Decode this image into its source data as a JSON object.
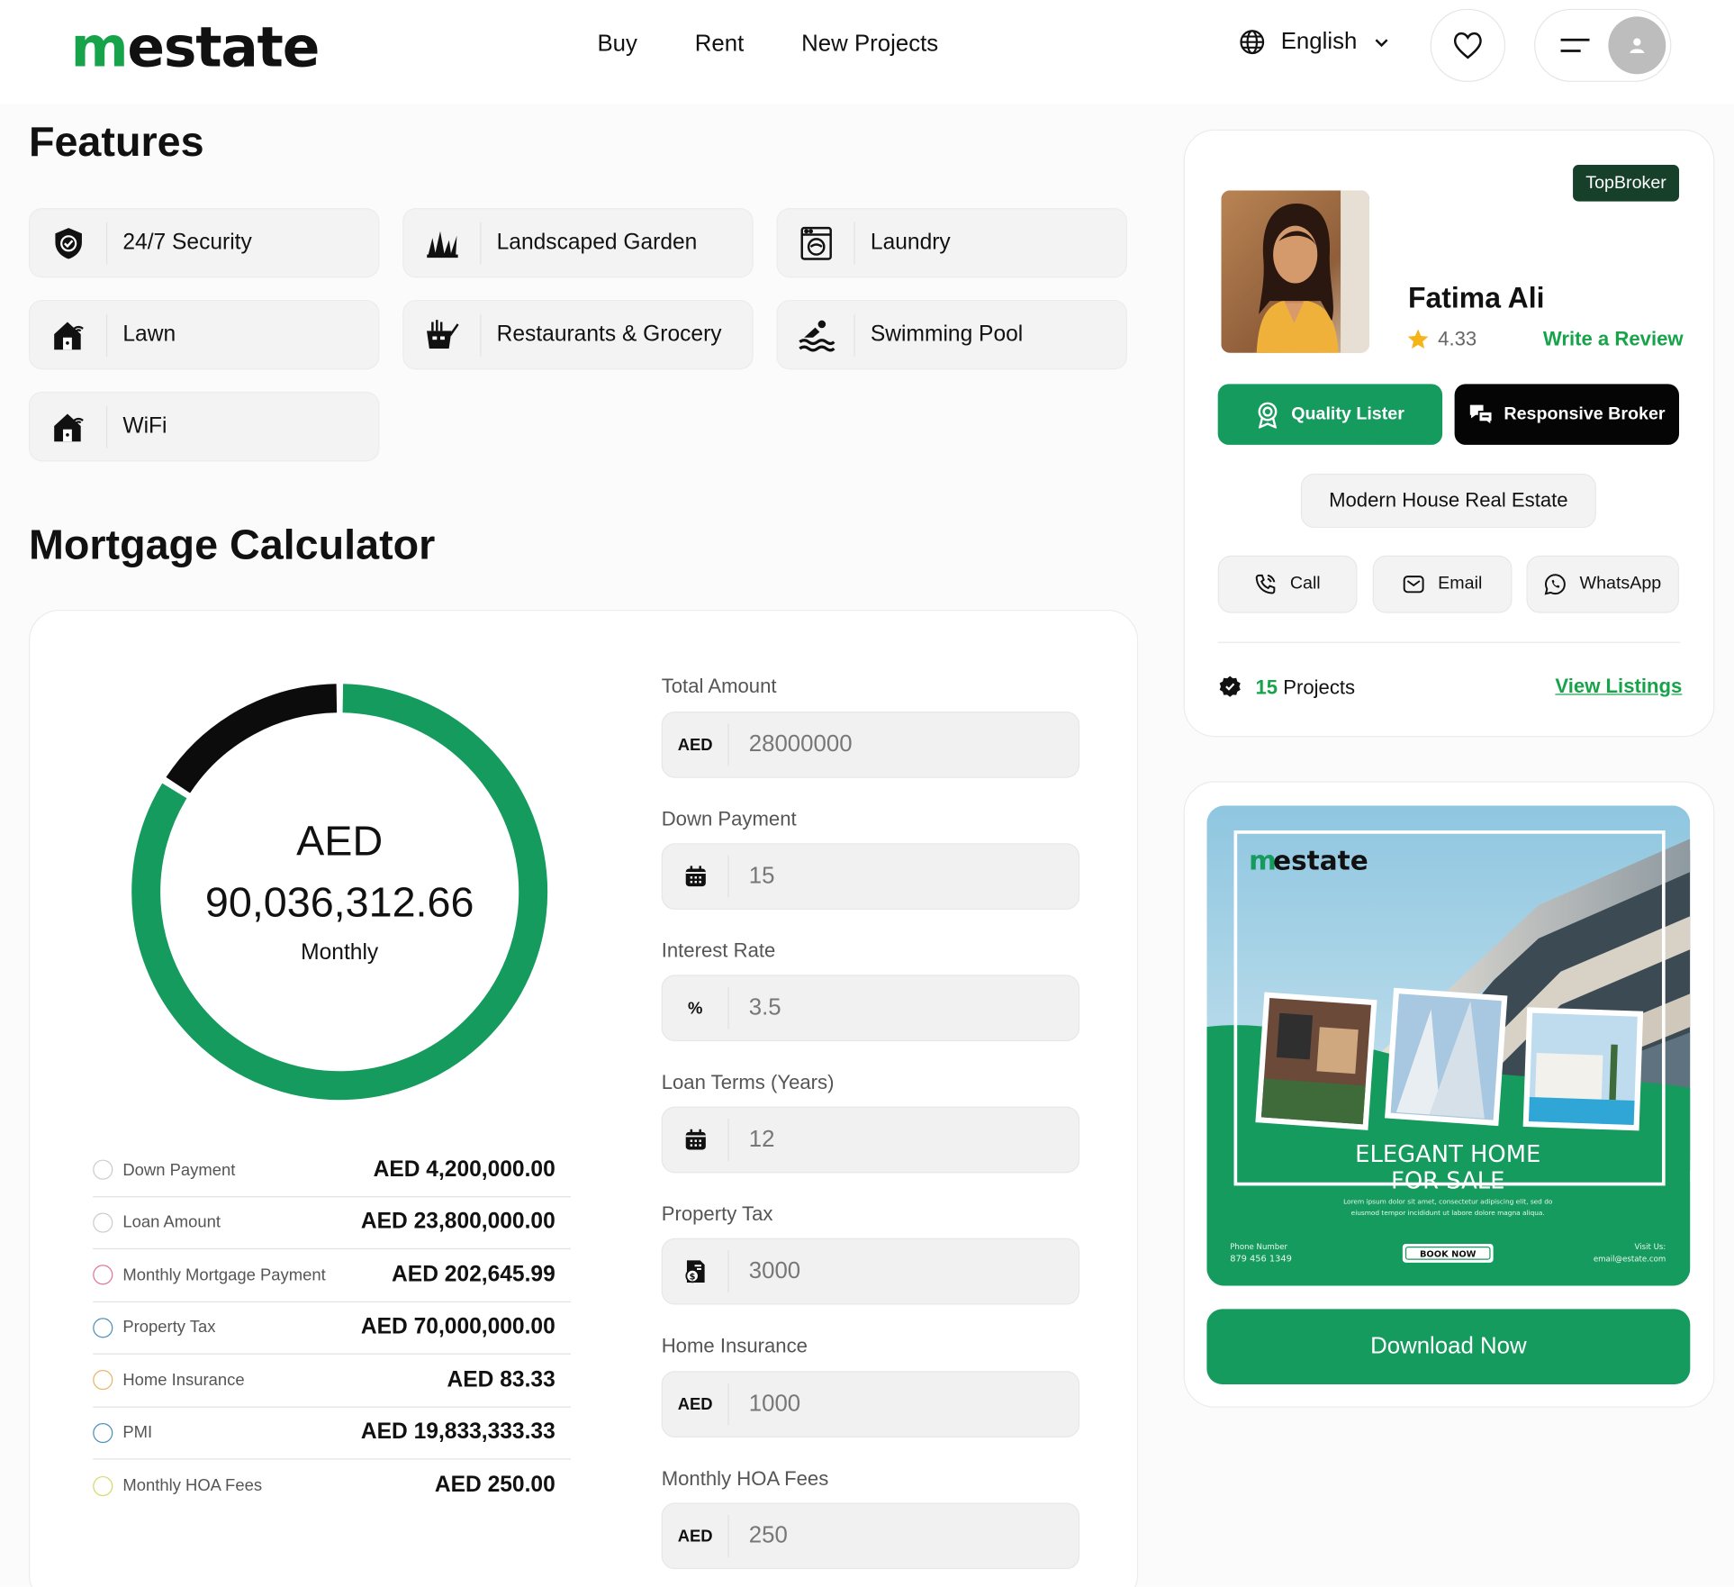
{
  "header": {
    "logo_m": "m",
    "logo_rest": "estate",
    "nav": [
      "Buy",
      "Rent",
      "New Projects"
    ],
    "language": "English"
  },
  "features": {
    "title": "Features",
    "items": [
      "24/7 Security",
      "Landscaped Garden",
      "Laundry",
      "Lawn",
      "Restaurants & Grocery",
      "Swimming Pool",
      "WiFi"
    ]
  },
  "mortgage": {
    "title": "Mortgage Calculator",
    "donut": {
      "currency": "AED",
      "amount": "90,036,312.66",
      "period": "Monthly",
      "green_fraction": 0.84,
      "black_fraction": 0.16
    },
    "legend": [
      {
        "label": "Down Payment",
        "value": "AED 4,200,000.00",
        "color": "#cccccc"
      },
      {
        "label": "Loan Amount",
        "value": "AED 23,800,000.00",
        "color": "#cccccc"
      },
      {
        "label": "Monthly Mortgage Payment",
        "value": "AED 202,645.99",
        "color": "#e0739a"
      },
      {
        "label": "Property Tax",
        "value": "AED 70,000,000.00",
        "color": "#4a90b8"
      },
      {
        "label": "Home Insurance",
        "value": "AED 83.33",
        "color": "#e8b56a"
      },
      {
        "label": "PMI",
        "value": "AED 19,833,333.33",
        "color": "#4a90b8"
      },
      {
        "label": "Monthly HOA Fees",
        "value": "AED 250.00",
        "color": "#d6d86a"
      }
    ],
    "fields": [
      {
        "label": "Total Amount",
        "prefix": "AED",
        "value": "28000000"
      },
      {
        "label": "Down Payment",
        "prefix": "calendar",
        "value": "15"
      },
      {
        "label": "Interest Rate",
        "prefix": "%",
        "value": "3.5"
      },
      {
        "label": "Loan Terms (Years)",
        "prefix": "calendar",
        "value": "12"
      },
      {
        "label": "Property Tax",
        "prefix": "tax",
        "value": "3000"
      },
      {
        "label": "Home Insurance",
        "prefix": "AED",
        "value": "1000"
      },
      {
        "label": "Monthly HOA Fees",
        "prefix": "AED",
        "value": "250"
      }
    ]
  },
  "broker": {
    "badge": "TopBroker",
    "name": "Fatima Ali",
    "rating": "4.33",
    "review_link": "Write a Review",
    "quality": "Quality Lister",
    "responsive": "Responsive Broker",
    "agency": "Modern House Real Estate",
    "call": "Call",
    "email": "Email",
    "whatsapp": "WhatsApp",
    "projects_count": "15",
    "projects_label": "Projects",
    "view_listings": "View Listings"
  },
  "ad": {
    "logo_m": "m",
    "logo_rest": "estate",
    "headline1": "ELEGANT HOME",
    "headline2": "FOR SALE",
    "lorem1": "Lorem ipsum dolor sit amet, consectetur adipiscing elit, sed do",
    "lorem2": "eiusmod tempor incididunt ut labore dolore magna aliqua.",
    "phone_label": "Phone Number",
    "phone": "879 456 1349",
    "book": "BOOK NOW",
    "visit_label": "Visit Us:",
    "visit": "email@estate.com",
    "download": "Download Now"
  },
  "colors": {
    "brand_green": "#169b5e",
    "dark": "#111111"
  }
}
